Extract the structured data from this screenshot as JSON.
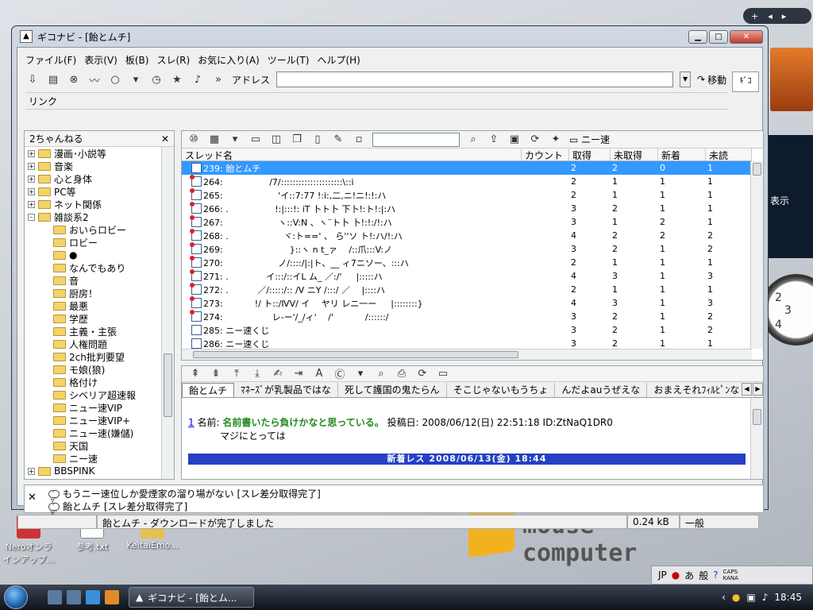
{
  "desktop": {
    "icons": [
      {
        "label": "Neroオンラ インアップ..."
      },
      {
        "label": "参考.txt"
      },
      {
        "label": "KeitaiEmo..."
      }
    ],
    "logo_text": "mouse computer",
    "side_label": "表示",
    "clock_numbers": [
      "2",
      "3",
      "4"
    ]
  },
  "window": {
    "title": "ギコナビ - [飴とムチ]",
    "menu": [
      "ファイル(F)",
      "表示(V)",
      "板(B)",
      "スレ(R)",
      "お気に入り(A)",
      "ツール(T)",
      "ヘルプ(H)"
    ],
    "address_label": "アドレス",
    "address_value": "",
    "go_label": "移動",
    "link_label": "リンク"
  },
  "tree": {
    "header": "2ちゃんねる",
    "nodes": [
      {
        "label": "漫画･小説等",
        "level": 0,
        "expander": "+"
      },
      {
        "label": "音楽",
        "level": 0,
        "expander": "+"
      },
      {
        "label": "心と身体",
        "level": 0,
        "expander": "+"
      },
      {
        "label": "PC等",
        "level": 0,
        "expander": "+"
      },
      {
        "label": "ネット関係",
        "level": 0,
        "expander": "+"
      },
      {
        "label": "雑談系2",
        "level": 0,
        "expander": "-"
      },
      {
        "label": "おいらロビー",
        "level": 1
      },
      {
        "label": "ロビー",
        "level": 1
      },
      {
        "label": "●",
        "level": 1
      },
      {
        "label": "なんでもあり",
        "level": 1
      },
      {
        "label": "音",
        "level": 1
      },
      {
        "label": "厨房！",
        "level": 1
      },
      {
        "label": "最悪",
        "level": 1
      },
      {
        "label": "学歴",
        "level": 1
      },
      {
        "label": "主義・主張",
        "level": 1
      },
      {
        "label": "人権問題",
        "level": 1
      },
      {
        "label": "2ch批判要望",
        "level": 1
      },
      {
        "label": "モ娘(狼)",
        "level": 1
      },
      {
        "label": "格付け",
        "level": 1
      },
      {
        "label": "シベリア超速報",
        "level": 1
      },
      {
        "label": "ニュー速VIP",
        "level": 1
      },
      {
        "label": "ニュー速VIP+",
        "level": 1
      },
      {
        "label": "ニュー速(嫌儲)",
        "level": 1
      },
      {
        "label": "天国",
        "level": 1
      },
      {
        "label": "ニー速",
        "level": 1
      },
      {
        "label": "BBSPINK",
        "level": 0,
        "expander": "+"
      }
    ]
  },
  "list": {
    "board_label": "ニー速",
    "columns": [
      "スレッド名",
      "カウント",
      "取得",
      "未取得",
      "新着",
      "未読"
    ],
    "rows": [
      {
        "name": "239: 飴とムチ",
        "count": "2",
        "got": "2",
        "notgot": "0",
        "new": "1",
        "sel": true,
        "newmark": false
      },
      {
        "name": "264: 　　　　　/7/:::::::::::::::::::::\\::i",
        "count": "2",
        "got": "1",
        "notgot": "1",
        "new": "1",
        "newmark": true
      },
      {
        "name": "265: 　　　　　　'イ::7:77 !:i:,二,ニ!ニ!:!:ハ",
        "count": "2",
        "got": "1",
        "notgot": "1",
        "new": "1",
        "newmark": true
      },
      {
        "name": "266: . 　　　　　!:|:::!: iT 卜ト卜 下卜!:ト!:|:ハ",
        "count": "3",
        "got": "2",
        "notgot": "1",
        "new": "1",
        "newmark": true
      },
      {
        "name": "267: 　　　　　　ヽ::V:N 、ヽ¨ト卜 卜!:!:/!:ハ",
        "count": "3",
        "got": "1",
        "notgot": "2",
        "new": "1",
        "newmark": true
      },
      {
        "name": "268: . 　　　　　　ヾ:ト==' 、 ら''ソ ト!:ハ/!:ハ",
        "count": "4",
        "got": "2",
        "notgot": "2",
        "new": "2",
        "newmark": true
      },
      {
        "name": "269: 　　　　　　　 }::ヽ n t_ァ 　/::爪:::V:ノ",
        "count": "3",
        "got": "2",
        "notgot": "1",
        "new": "2",
        "newmark": true
      },
      {
        "name": "270: 　　　　　　ノ/::::/|:|ト、__ ィ7ニソー、:::ハ",
        "count": "2",
        "got": "1",
        "notgot": "1",
        "new": "1",
        "newmark": true
      },
      {
        "name": "271: . 　　　　イ:::/::イL ム_ ／:/' 　 |:::::ハ",
        "count": "4",
        "got": "3",
        "notgot": "1",
        "new": "3",
        "newmark": true
      },
      {
        "name": "272: . 　　　／/:::::/:: /V ニY /:::/ ／ 　|::::ハ",
        "count": "2",
        "got": "1",
        "notgot": "1",
        "new": "1",
        "newmark": true
      },
      {
        "name": "273: 　　　 !/ ト::/ⅣV/ イ 　ヤリ レニ一ー 　 |::::::::}",
        "count": "4",
        "got": "3",
        "notgot": "1",
        "new": "3",
        "newmark": true
      },
      {
        "name": "274: 　　　　　 レ-ー'/_/ィ' 　/' 　　　 /::::::/",
        "count": "3",
        "got": "2",
        "notgot": "1",
        "new": "2",
        "newmark": true
      },
      {
        "name": "285: ニー速くじ",
        "count": "3",
        "got": "2",
        "notgot": "1",
        "new": "2",
        "newmark": false
      },
      {
        "name": "286: ニー速くじ",
        "count": "3",
        "got": "2",
        "notgot": "1",
        "new": "1",
        "newmark": false
      }
    ]
  },
  "view": {
    "tabs": [
      "飴とムチ",
      "ﾏﾈｰｽﾞが乳製品ではな",
      "死して護国の鬼たらん",
      "そこじゃないもうちょ",
      "んだよauうぜえな",
      "おまえそれﾌｨﾙﾋﾟﾝなじ"
    ],
    "post": {
      "number": "1",
      "name_label": "名前:",
      "name": "名前書いたら負けかなと思っている。",
      "date_label": "投稿日:",
      "date": "2008/06/12(日) 22:51:18",
      "id": "ID:ZtNaQ1DR0",
      "body": "マジにとっては"
    },
    "new_bar": "新着レス 2008/06/13(金) 18:44"
  },
  "log": [
    "もうニー速位しか愛煙家の溜り場がない [スレ差分取得完了]",
    "飴とムチ [スレ差分取得完了]"
  ],
  "status": {
    "message": "飴とムチ - ダウンロードが完了しました",
    "size": "0.24 kB",
    "mode": "一般"
  },
  "taskbar": {
    "task_label": "ギコナビ - [飴とム...",
    "clock": "18:45",
    "lang": "JP",
    "ime": [
      "あ",
      "般"
    ],
    "caps": "CAPS KANA"
  }
}
